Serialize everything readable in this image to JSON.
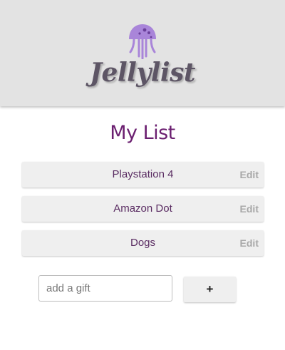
{
  "app": {
    "logo_text": "Jellylist",
    "logo_icon": "jellyfish-icon"
  },
  "page": {
    "title": "My List"
  },
  "list": {
    "items": [
      {
        "label": "Playstation 4",
        "action": "Edit"
      },
      {
        "label": "Amazon Dot",
        "action": "Edit"
      },
      {
        "label": "Dogs",
        "action": "Edit"
      }
    ]
  },
  "add_form": {
    "placeholder": "add a gift",
    "value": "",
    "button_label": "+"
  },
  "colors": {
    "header_bg": "#e3e3e3",
    "title": "#6b1f70",
    "jellyfish": "#a985d9",
    "item_bg": "#efefef",
    "edit_text": "#a8a8a8"
  }
}
